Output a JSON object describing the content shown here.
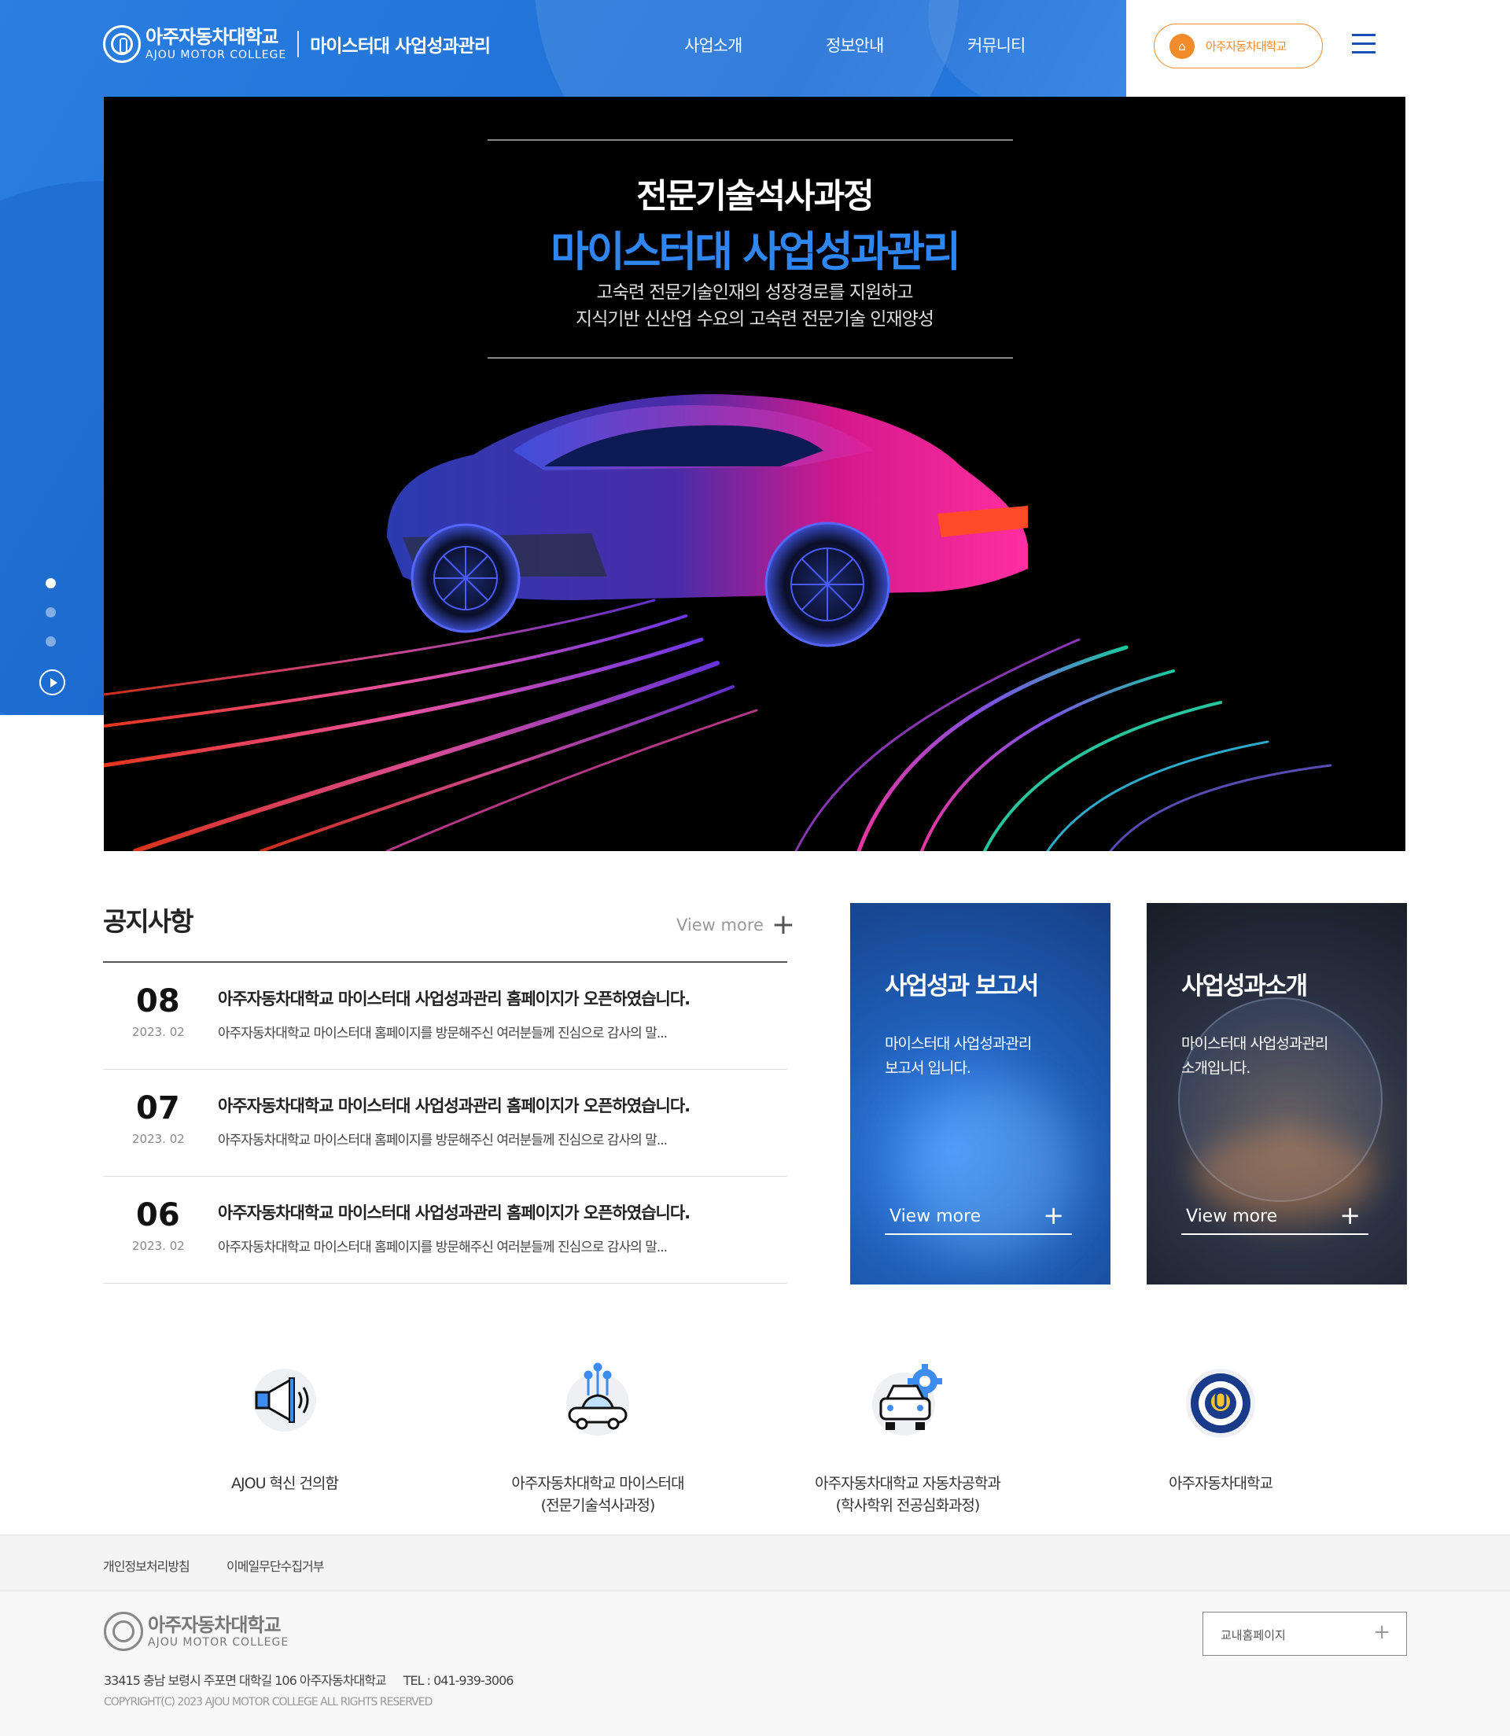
{
  "header": {
    "logo_ko": "아주자동차대학교",
    "logo_en": "AJOU MOTOR COLLEGE",
    "site_title": "마이스터대 사업성과관리",
    "nav": [
      {
        "label": "사업소개"
      },
      {
        "label": "정보안내"
      },
      {
        "label": "커뮤니티"
      }
    ],
    "univ_button": "아주자동차대학교",
    "menu_icon": "hamburger-icon"
  },
  "hero": {
    "subtitle": "전문기술석사과정",
    "title": "마이스터대 사업성과관리",
    "desc_line1": "고숙련 전문기술인재의 성장경로를 지원하고",
    "desc_line2": "지식기반 신산업 수요의 고숙련 전문기술 인재양성",
    "slides": 3,
    "active_slide": 1
  },
  "notice": {
    "title": "공지사항",
    "more_label": "View more",
    "items": [
      {
        "day": "08",
        "date": "2023. 02",
        "title": "아주자동차대학교 마이스터대 사업성과관리 홈페이지가 오픈하였습니다.",
        "text": "아주자동차대학교 마이스터대 홈페이지를 방문해주신 여러분들께 진심으로 감사의 말..."
      },
      {
        "day": "07",
        "date": "2023. 02",
        "title": "아주자동차대학교 마이스터대 사업성과관리 홈페이지가 오픈하였습니다.",
        "text": "아주자동차대학교 마이스터대 홈페이지를 방문해주신 여러분들께 진심으로 감사의 말..."
      },
      {
        "day": "06",
        "date": "2023. 02",
        "title": "아주자동차대학교 마이스터대 사업성과관리 홈페이지가 오픈하였습니다.",
        "text": "아주자동차대학교 마이스터대 홈페이지를 방문해주신 여러분들께 진심으로 감사의 말..."
      }
    ]
  },
  "cards": [
    {
      "title": "사업성과 보고서",
      "line1": "마이스터대 사업성과관리",
      "line2": "보고서 입니다.",
      "more": "View more"
    },
    {
      "title": "사업성과소개",
      "line1": "마이스터대 사업성과관리",
      "line2": "소개입니다.",
      "more": "View more"
    }
  ],
  "quick_links": [
    {
      "label1": "AJOU 혁신 건의함",
      "label2": "",
      "icon": "megaphone-icon"
    },
    {
      "label1": "아주자동차대학교 마이스터대",
      "label2": "(전문기술석사과정)",
      "icon": "smart-car-icon"
    },
    {
      "label1": "아주자동차대학교 자동차공학과",
      "label2": "(학사학위 전공심화과정)",
      "icon": "car-gear-icon"
    },
    {
      "label1": "아주자동차대학교",
      "label2": "",
      "icon": "college-emblem-icon"
    }
  ],
  "footer": {
    "links": [
      "개인정보처리방침",
      "이메일무단수집거부"
    ],
    "logo_ko": "아주자동차대학교",
    "logo_en": "AJOU MOTOR COLLEGE",
    "address": "33415 충남 보령시 주포면 대학길 106 아주자동차대학교",
    "tel": "TEL : 041-939-3006",
    "copyright": "COPYRIGHT(C) 2023 AJOU MOTOR COLLEGE ALL RIGHTS RESERVED",
    "family_site": "교내홈페이지"
  },
  "colors": {
    "brand_blue": "#1f6fd6",
    "accent_orange": "#f28b2a",
    "hero_title_blue": "#2f86f0"
  }
}
